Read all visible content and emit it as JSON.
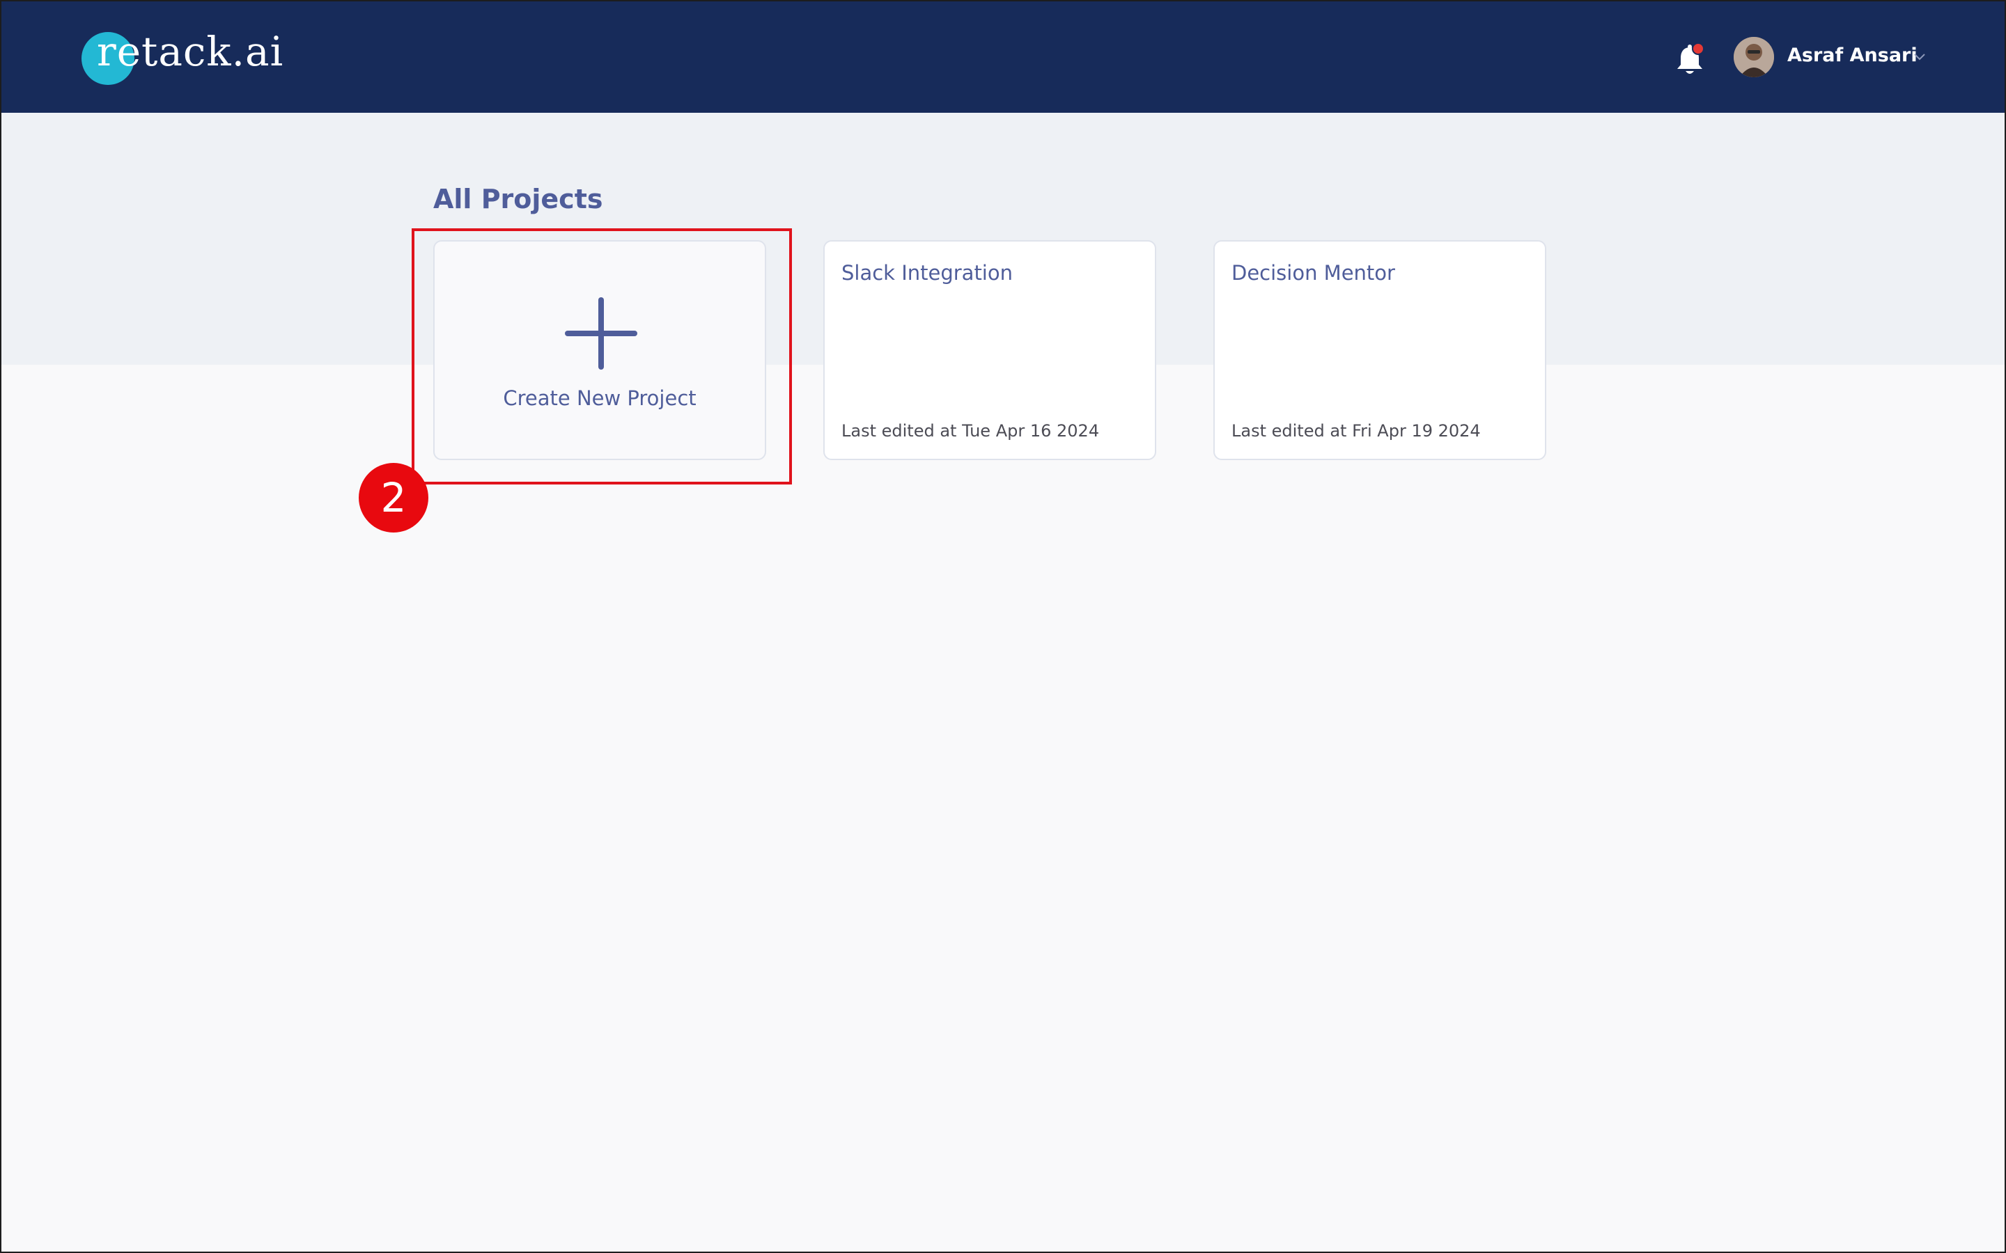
{
  "header": {
    "logo_text": "retack.ai",
    "user_name": "Asraf Ansari",
    "notification_dot_color": "#e53935",
    "background_color": "#172b5a",
    "logo_accent_color": "#23b8d4"
  },
  "main": {
    "title": "All Projects",
    "create_card": {
      "label": "Create New Project"
    },
    "projects": [
      {
        "name": "Slack Integration",
        "last_edited": "Last edited at Tue Apr 16 2024"
      },
      {
        "name": "Decision Mentor",
        "last_edited": "Last edited at Fri Apr 19 2024"
      }
    ]
  },
  "annotation": {
    "step_number": "2",
    "color": "#e0131c"
  }
}
